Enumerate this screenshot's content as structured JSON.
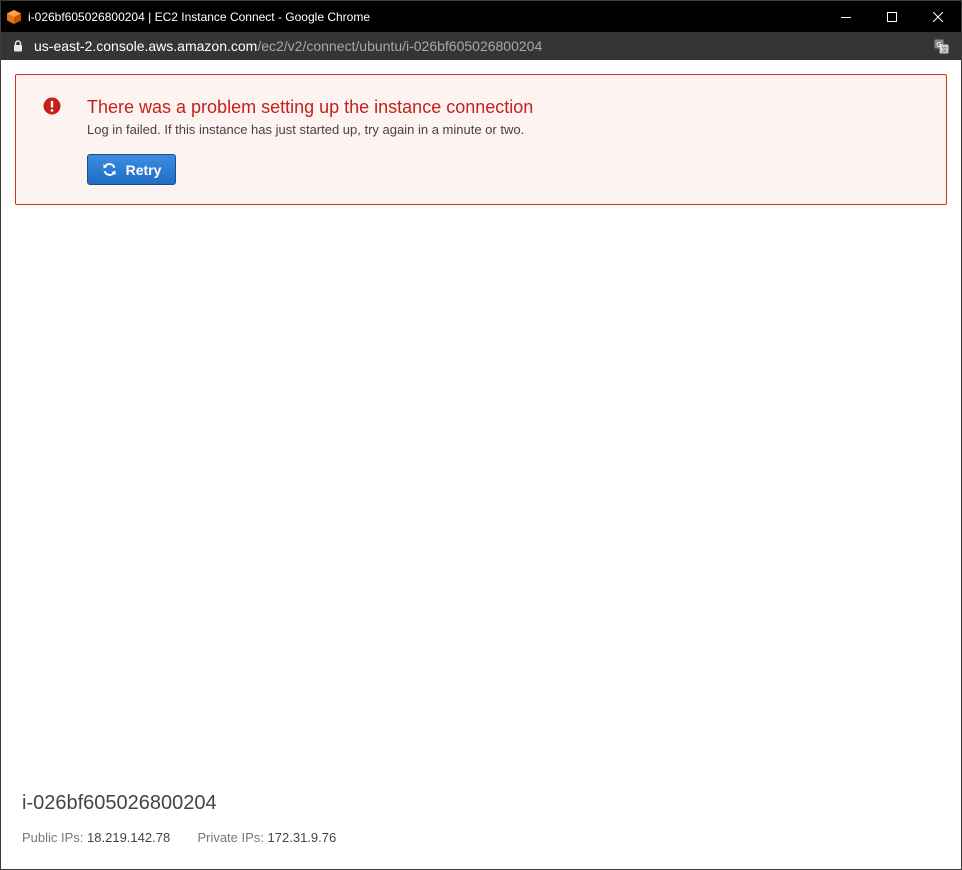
{
  "window": {
    "title": "i-026bf605026800204 | EC2 Instance Connect - Google Chrome"
  },
  "addressbar": {
    "url_host": "us-east-2.console.aws.amazon.com",
    "url_path": "/ec2/v2/connect/ubuntu/i-026bf605026800204"
  },
  "alert": {
    "title": "There was a problem setting up the instance connection",
    "message": "Log in failed. If this instance has just started up, try again in a minute or two.",
    "retry_label": "Retry",
    "border_color": "#d13212",
    "title_color": "#c7201a"
  },
  "instance": {
    "id": "i-026bf605026800204",
    "public_ips_label": "Public IPs:",
    "public_ips_value": "18.219.142.78",
    "private_ips_label": "Private IPs:",
    "private_ips_value": "172.31.9.76"
  },
  "icons": {
    "app": "aws-cube-icon",
    "lock": "lock-icon",
    "translate": "translate-icon",
    "error": "error-circle-icon",
    "retry": "refresh-icon"
  }
}
